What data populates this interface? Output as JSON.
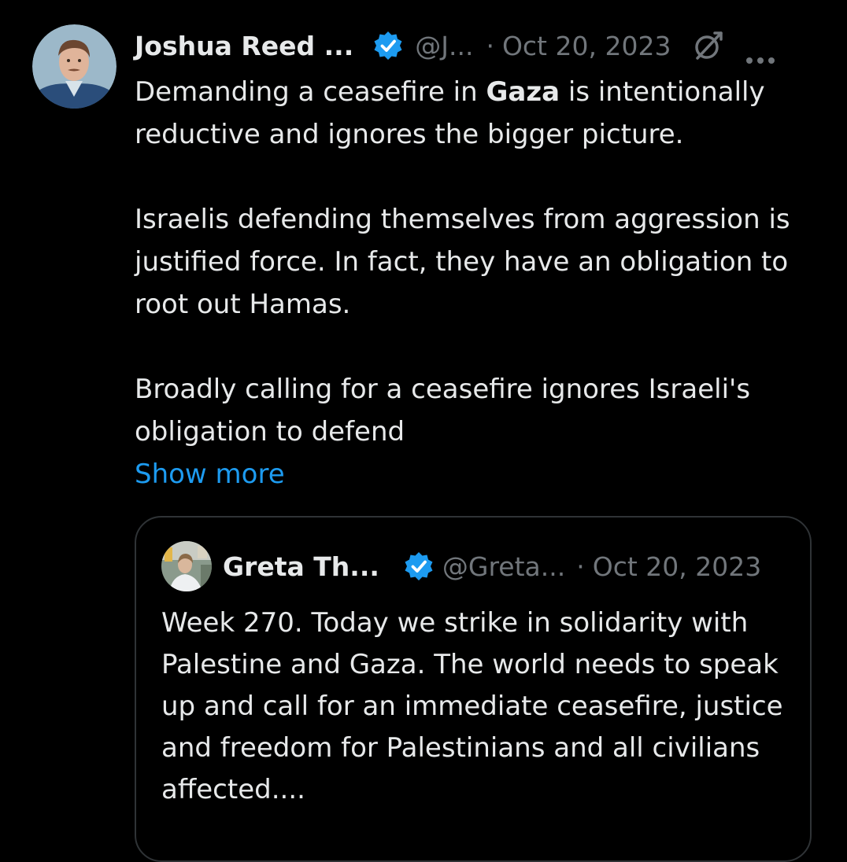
{
  "colors": {
    "background": "#000000",
    "text": "#e7e9ea",
    "muted": "#71767b",
    "link": "#1d9bf0",
    "verified": "#1d9bf0",
    "border": "#2f3336"
  },
  "tweet": {
    "author_name": "Joshua Reed ...",
    "handle": "@J...",
    "separator": "·",
    "date": "Oct 20, 2023",
    "avatar_icon": "profile-photo",
    "verified_icon": "verified-badge-icon",
    "grok_icon": "grok-icon",
    "more_icon": "more-options-icon",
    "body": {
      "line1_before": "Demanding a ceasefire in ",
      "line1_bold": "Gaza",
      "line1_after": " is intentionally reductive and ignores the bigger picture.",
      "paragraph2": "Israelis defending themselves from aggression is justified force. In fact, they have an obligation to root out Hamas.",
      "paragraph3": "Broadly calling for a ceasefire ignores Israeli's obligation to defend"
    },
    "show_more": "Show more"
  },
  "quote": {
    "author_name": "Greta Th...",
    "handle": "@Greta...",
    "separator": "·",
    "date": "Oct 20, 2023",
    "verified_icon": "verified-badge-icon",
    "body": "Week 270. Today we strike in solidarity with Palestine and Gaza. The world needs to speak up and call for an immediate ceasefire, justice and freedom for Palestinians and all civilians affected...."
  }
}
